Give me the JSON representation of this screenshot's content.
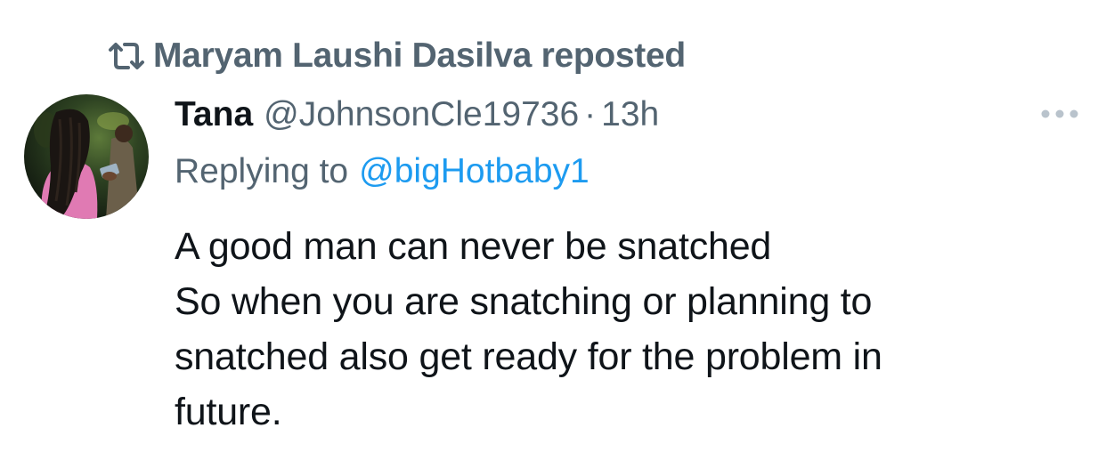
{
  "repost": {
    "icon": "repost-icon",
    "text": "Maryam Laushi Dasilva reposted"
  },
  "tweet": {
    "author": {
      "display_name": "Tana",
      "handle": "@JohnsonCle19736",
      "avatar": "avatar-photo"
    },
    "separator": "·",
    "time": "13h",
    "more_icon": "more-horizontal-icon",
    "reply": {
      "label": "Replying to",
      "to": "@bigHotbaby1"
    },
    "text_lines": [
      "A good man can never be snatched",
      "So when you are snatching or planning to",
      "snatched also get ready for the problem in",
      "future."
    ]
  },
  "colors": {
    "text_primary": "#0f1419",
    "text_secondary": "#536471",
    "link": "#1d9bf0",
    "icon_gray": "#b9c3cc"
  }
}
